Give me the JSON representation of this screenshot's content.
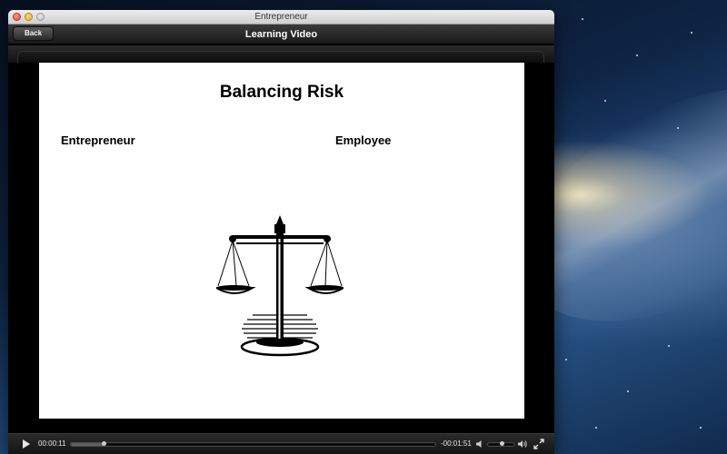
{
  "window": {
    "title": "Entrepreneur"
  },
  "toolbar": {
    "back_label": "Back",
    "title": "Learning Video"
  },
  "slide": {
    "title": "Balancing Risk",
    "left_heading": "Entrepreneur",
    "right_heading": "Employee",
    "image": "scales-of-justice-illustration"
  },
  "player": {
    "elapsed": "00:00:11",
    "remaining": "-00:01:51",
    "progress_fraction": 0.09,
    "volume_fraction": 0.55,
    "icons": {
      "play": "play-icon",
      "volume_low": "volume-low-icon",
      "volume_high": "volume-high-icon",
      "fullscreen": "fullscreen-icon"
    }
  },
  "colors": {
    "toolbar_text": "#ffffff",
    "slide_background": "#ffffff",
    "player_background": "#1f1f1f"
  }
}
